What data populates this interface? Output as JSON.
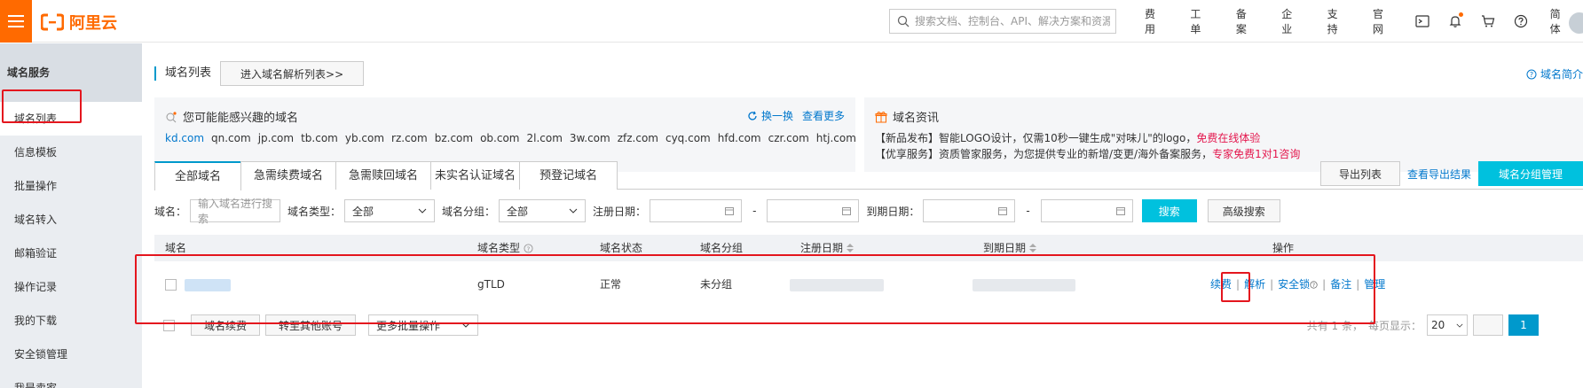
{
  "brand": {
    "name": "阿里云"
  },
  "header": {
    "search_placeholder": "搜索文档、控制台、API、解决方案和资源",
    "nav": [
      "费用",
      "工单",
      "备案",
      "企业",
      "支持",
      "官网"
    ],
    "lang": "简体"
  },
  "sidebar": {
    "title": "域名服务",
    "items": [
      {
        "label": "域名列表",
        "active": true
      },
      {
        "label": "信息模板"
      },
      {
        "label": "批量操作"
      },
      {
        "label": "域名转入"
      },
      {
        "label": "邮箱验证"
      },
      {
        "label": "操作记录"
      },
      {
        "label": "我的下载"
      },
      {
        "label": "安全锁管理"
      },
      {
        "label": "我是卖家"
      }
    ]
  },
  "page": {
    "title": "域名列表",
    "parse_button": "进入域名解析列表>>",
    "intro_link": "域名简介"
  },
  "interest": {
    "title": "您可能能感兴趣的域名",
    "refresh": "换一换",
    "more": "查看更多",
    "domains": [
      "kd.com",
      "qn.com",
      "jp.com",
      "tb.com",
      "yb.com",
      "rz.com",
      "bz.com",
      "ob.com",
      "2l.com",
      "3w.com",
      "zfz.com",
      "cyq.com",
      "hfd.com",
      "czr.com",
      "htj.com"
    ]
  },
  "news": {
    "title": "域名资讯",
    "line1_text": "【新品发布】智能LOGO设计，仅需10秒一键生成\"对味儿\"的logo，",
    "line1_link": "免费在线体验",
    "line2_text": "【优享服务】资质管家服务，为您提供专业的新增/变更/海外备案服务，",
    "line2_link": "专家免费1对1咨询"
  },
  "tabs": [
    "全部域名",
    "急需续费域名",
    "急需赎回域名",
    "未实名认证域名",
    "预登记域名"
  ],
  "tab_actions": {
    "export": "导出列表",
    "view_export": "查看导出结果",
    "group_manage": "域名分组管理"
  },
  "filters": {
    "domain_label": "域名：",
    "domain_placeholder": "输入域名进行搜索",
    "type_label": "域名类型：",
    "type_value": "全部",
    "group_label": "域名分组：",
    "group_value": "全部",
    "reg_label": "注册日期：",
    "exp_label": "到期日期：",
    "dash": "-",
    "search": "搜索",
    "advanced": "高级搜索"
  },
  "table": {
    "headers": {
      "domain": "域名",
      "type": "域名类型",
      "status": "域名状态",
      "group": "域名分组",
      "reg": "注册日期",
      "exp": "到期日期",
      "ops": "操作"
    },
    "row": {
      "type": "gTLD",
      "status": "正常",
      "group": "未分组"
    },
    "ops": [
      "续费",
      "解析",
      "安全锁",
      "备注",
      "管理"
    ]
  },
  "footer": {
    "renew": "域名续费",
    "transfer": "转至其他账号",
    "batch": "更多批量操作",
    "total": "共有 1 条，",
    "per_page": "每页显示：",
    "page_size": "20",
    "current_page": "1"
  },
  "colors": {
    "brand": "#ff6a00",
    "accent": "#00c1de",
    "link": "#0077cc",
    "highlight_box": "#e4161e"
  }
}
